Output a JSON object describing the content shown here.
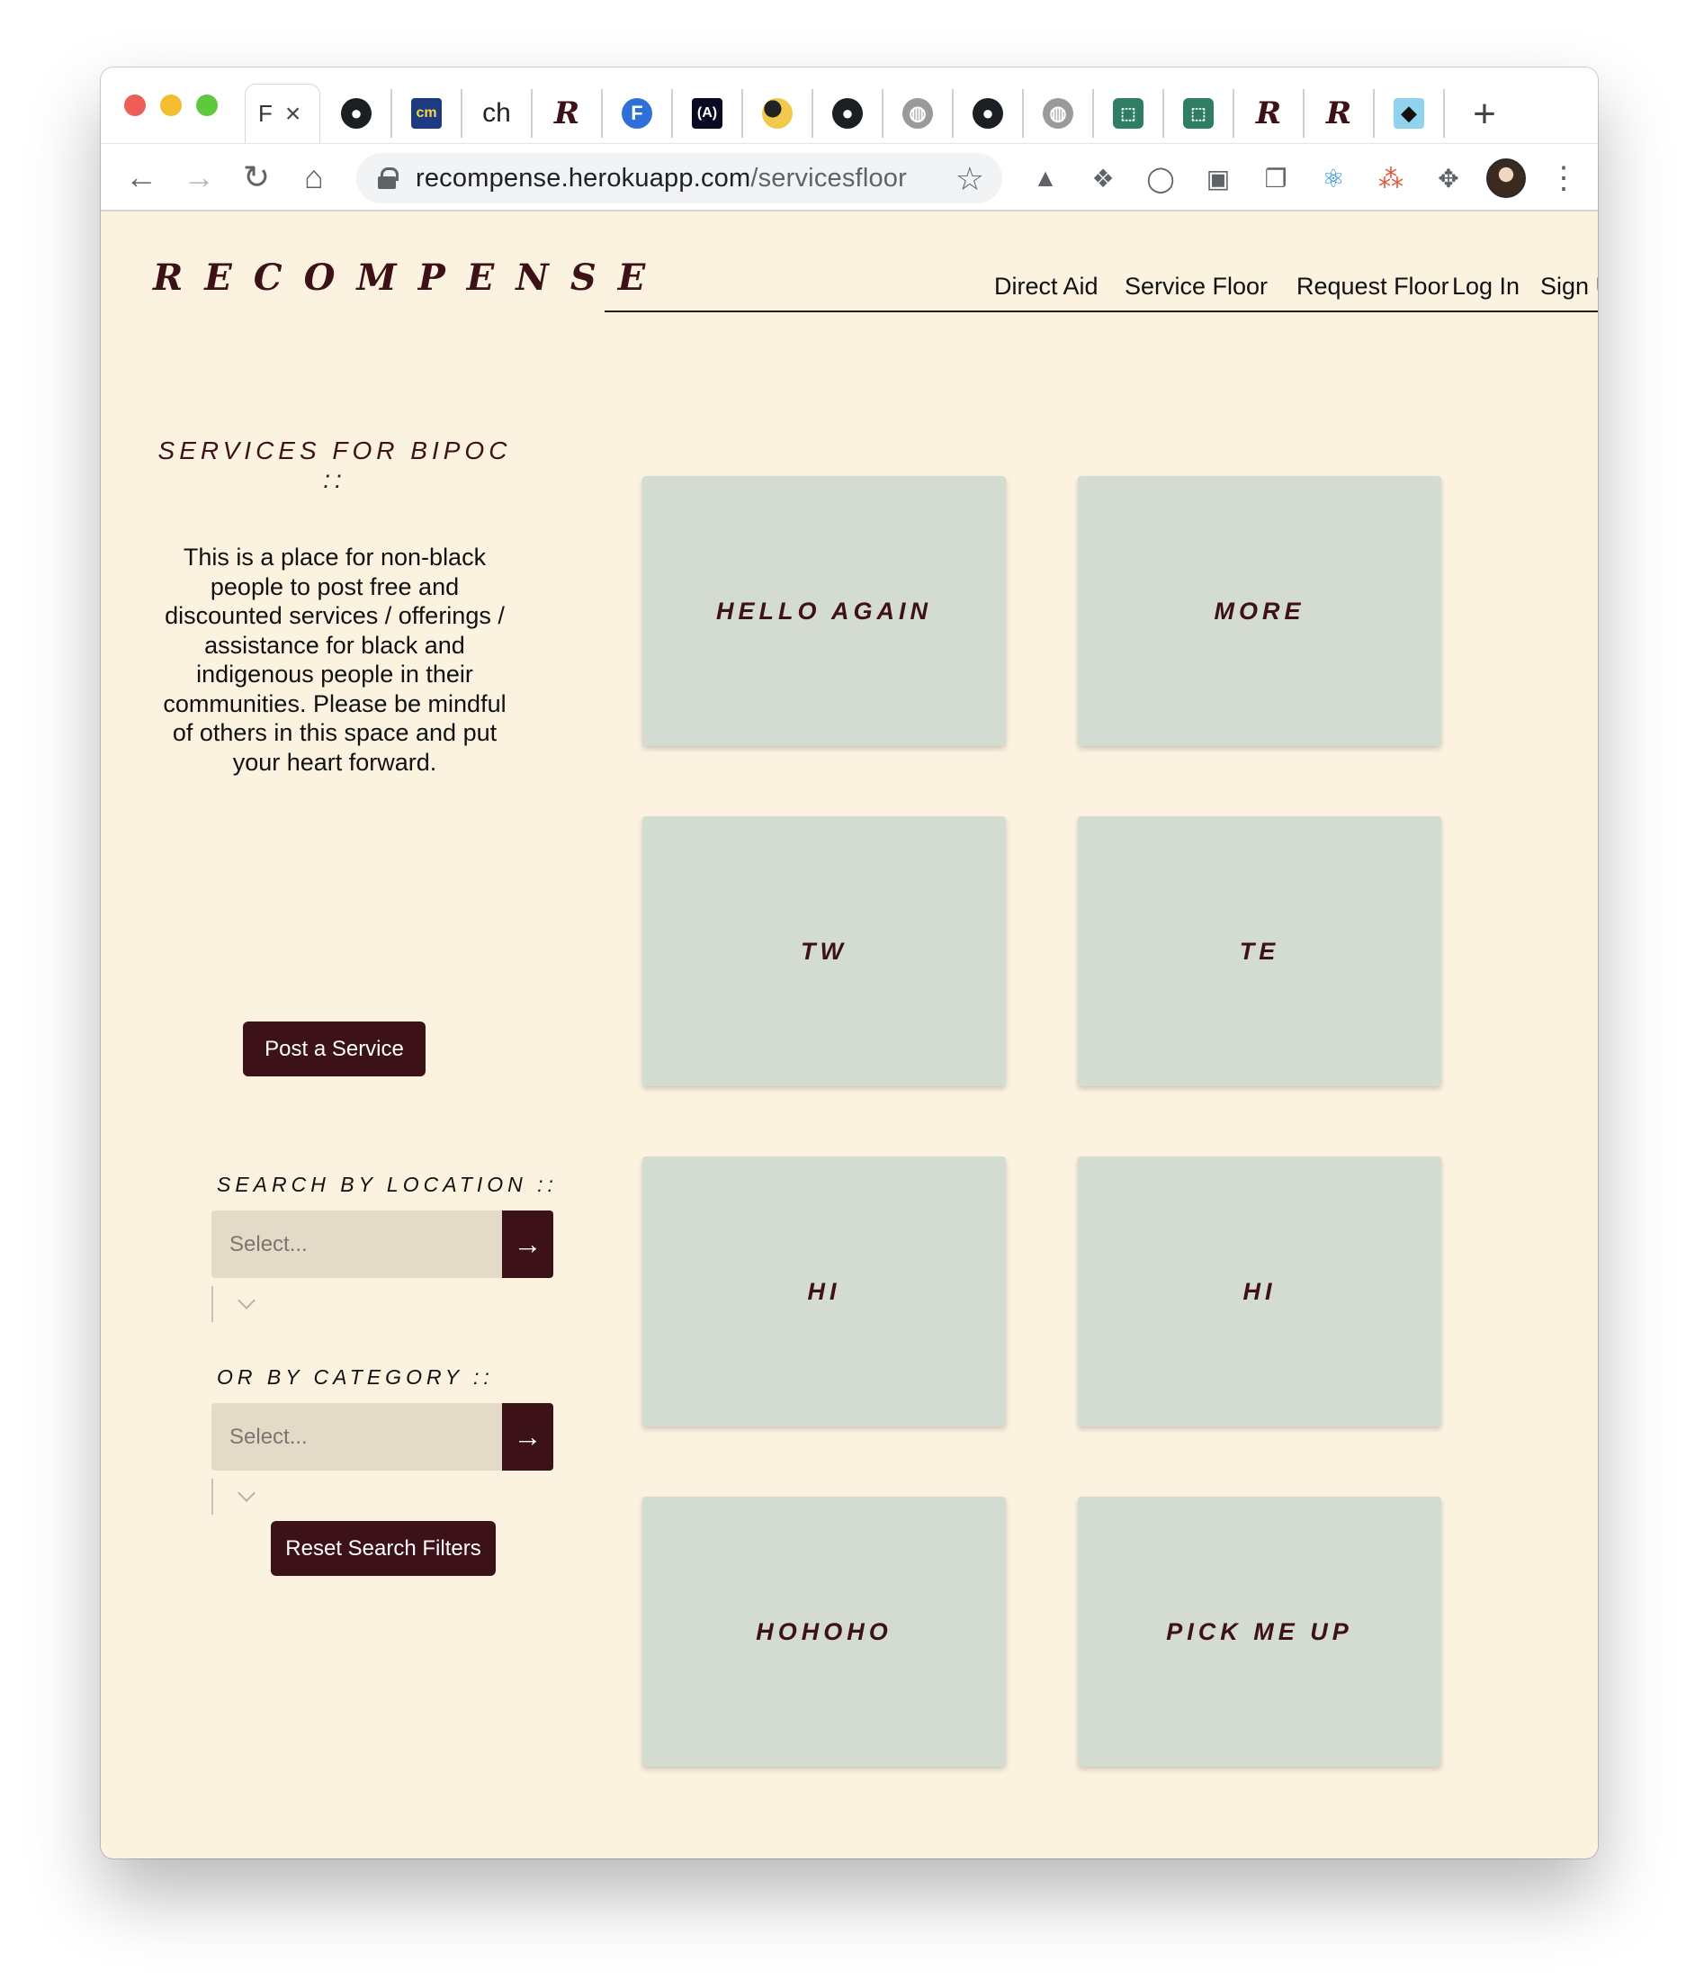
{
  "browser": {
    "active_tab_label": "F",
    "url_host": "recompense.herokuapp.com",
    "url_path": "/servicesfloor",
    "tabs": [
      {
        "icon": "github-icon",
        "glyph": "●"
      },
      {
        "icon": "cm-icon",
        "glyph": "cm"
      },
      {
        "icon": "text-tab",
        "glyph": "ch"
      },
      {
        "icon": "recompense-icon",
        "glyph": "R"
      },
      {
        "icon": "f-icon",
        "glyph": "F"
      },
      {
        "icon": "code-icon",
        "glyph": "(A)"
      },
      {
        "icon": "yinyang-icon",
        "glyph": ""
      },
      {
        "icon": "github-icon",
        "glyph": "●"
      },
      {
        "icon": "globe-icon",
        "glyph": "◍"
      },
      {
        "icon": "github-icon",
        "glyph": "●"
      },
      {
        "icon": "globe-icon",
        "glyph": "◍"
      },
      {
        "icon": "extension-icon",
        "glyph": "⬚"
      },
      {
        "icon": "extension-icon",
        "glyph": "⬚"
      },
      {
        "icon": "recompense-icon",
        "glyph": "R"
      },
      {
        "icon": "recompense-icon",
        "glyph": "R"
      },
      {
        "icon": "bird-icon",
        "glyph": "◆"
      }
    ]
  },
  "site": {
    "logo": "RECOMPENSE",
    "nav": [
      "Direct Aid",
      "Service Floor",
      "Request Floor",
      "Log In",
      "Sign Up"
    ]
  },
  "sidebar": {
    "heading": "SERVICES FOR BIPOC ::",
    "description": "This is a place for non-black people to post free and discounted services / offerings / assistance for black and indigenous people in their communities. Please be mindful of others in this space and put your heart forward.",
    "post_button": "Post a Service",
    "location_label": "SEARCH BY LOCATION ::",
    "location_placeholder": "Select...",
    "category_label": "OR BY CATEGORY ::",
    "category_placeholder": "Select...",
    "arrow": "→",
    "reset_button": "Reset Search Filters"
  },
  "cards": [
    "HELLO AGAIN",
    "MORE",
    "TW",
    "TE",
    "HI",
    "HI",
    "HOHOHO",
    "PICK ME UP"
  ],
  "colors": {
    "page_bg": "#fcf2e0",
    "brand_dark": "#3c1117",
    "card_bg": "#d4dbd0",
    "select_bg": "#e3dac8"
  }
}
